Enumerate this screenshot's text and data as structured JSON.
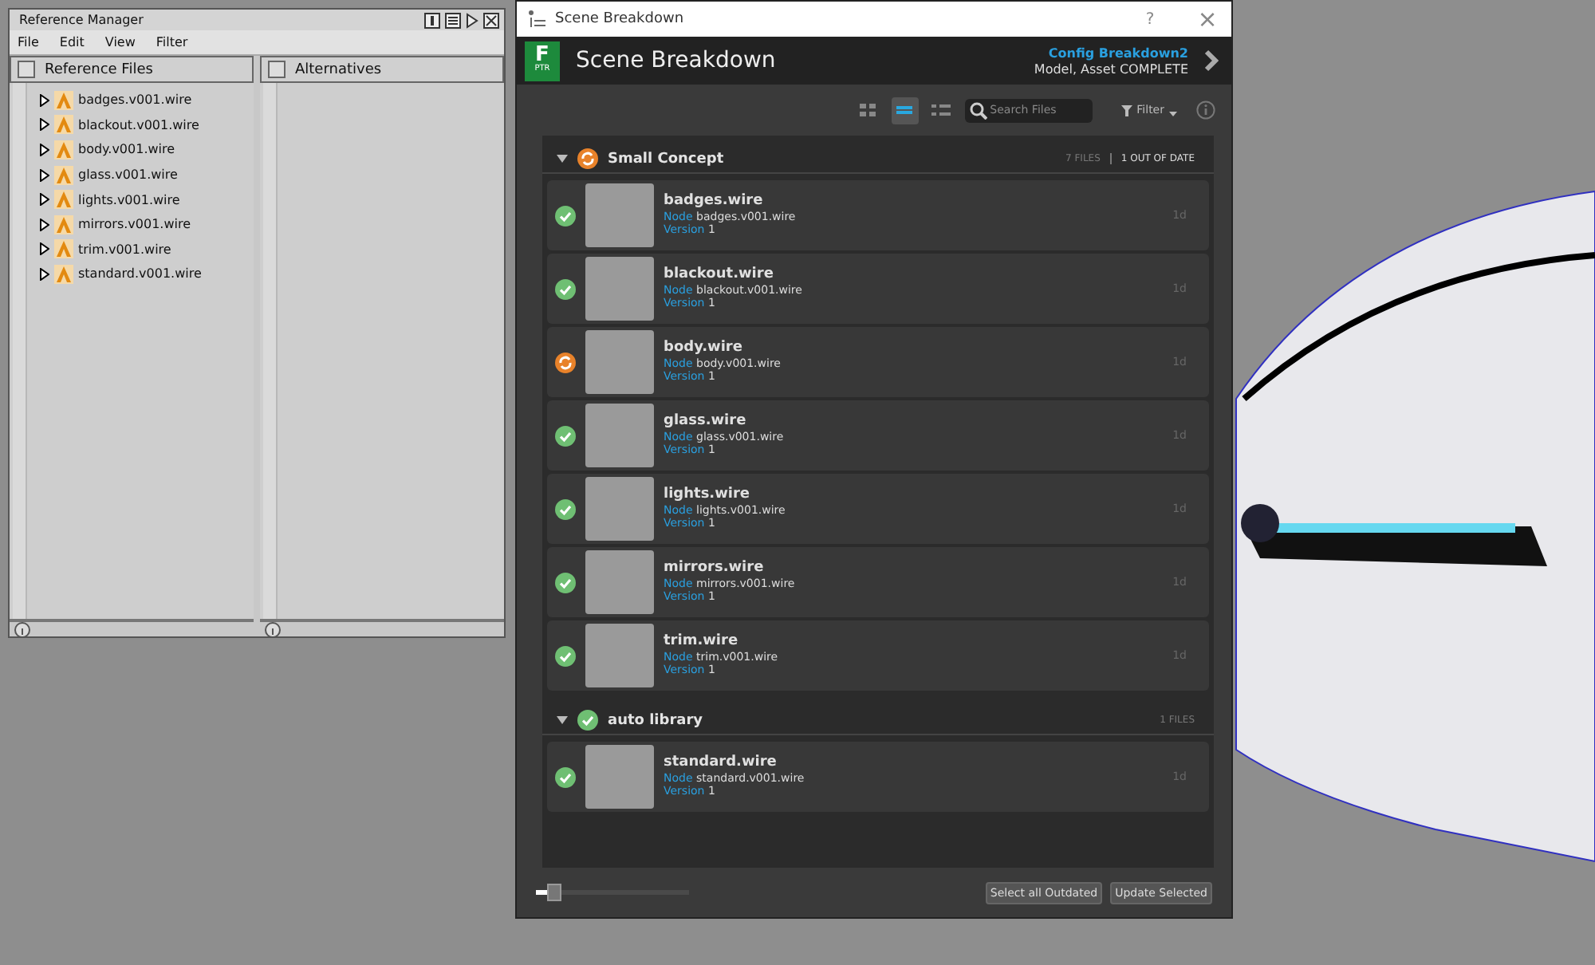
{
  "reference_manager": {
    "title": "Reference Manager",
    "menu": [
      "File",
      "Edit",
      "View",
      "Filter"
    ],
    "panes": [
      {
        "header": "Reference Files",
        "checked": false,
        "items": [
          "badges.v001.wire",
          "blackout.v001.wire",
          "body.v001.wire",
          "glass.v001.wire",
          "lights.v001.wire",
          "mirrors.v001.wire",
          "trim.v001.wire",
          "standard.v001.wire"
        ]
      },
      {
        "header": "Alternatives",
        "checked": false
      }
    ]
  },
  "scene_breakdown": {
    "window_title": "Scene Breakdown",
    "help": "?",
    "close": "×",
    "logo": {
      "letter": "F",
      "caption": "PTR"
    },
    "title": "Scene Breakdown",
    "config": "Config Breakdown2",
    "status": "Model, Asset COMPLETE",
    "view_modes": [
      {
        "kind": "grid",
        "selected": false
      },
      {
        "kind": "list",
        "selected": true
      },
      {
        "kind": "detail",
        "selected": false
      }
    ],
    "search": {
      "placeholder": "Search Files"
    },
    "filter": "Filter",
    "groups": [
      {
        "name": "Small Concept",
        "kind": "outdated",
        "expanded": true,
        "count": "7 FILES",
        "outdated": "1 OUT OF DATE",
        "items": [
          {
            "name": "badges.wire",
            "kind": "ok",
            "node_label": "Node",
            "node": "badges.v001.wire",
            "version_label": "Version",
            "version": "1",
            "age": "1d"
          },
          {
            "name": "blackout.wire",
            "kind": "ok",
            "node_label": "Node",
            "node": "blackout.v001.wire",
            "version_label": "Version",
            "version": "1",
            "age": "1d"
          },
          {
            "name": "body.wire",
            "kind": "outdated",
            "node_label": "Node",
            "node": "body.v001.wire",
            "version_label": "Version",
            "version": "1",
            "age": "1d"
          },
          {
            "name": "glass.wire",
            "kind": "ok",
            "node_label": "Node",
            "node": "glass.v001.wire",
            "version_label": "Version",
            "version": "1",
            "age": "1d"
          },
          {
            "name": "lights.wire",
            "kind": "ok",
            "node_label": "Node",
            "node": "lights.v001.wire",
            "version_label": "Version",
            "version": "1",
            "age": "1d"
          },
          {
            "name": "mirrors.wire",
            "kind": "ok",
            "node_label": "Node",
            "node": "mirrors.v001.wire",
            "version_label": "Version",
            "version": "1",
            "age": "1d"
          },
          {
            "name": "trim.wire",
            "kind": "ok",
            "node_label": "Node",
            "node": "trim.v001.wire",
            "version_label": "Version",
            "version": "1",
            "age": "1d"
          }
        ]
      },
      {
        "name": "auto library",
        "kind": "ok",
        "expanded": true,
        "count": "1 FILES",
        "items": [
          {
            "name": "standard.wire",
            "kind": "ok",
            "node_label": "Node",
            "node": "standard.v001.wire",
            "version_label": "Version",
            "version": "1",
            "age": "1d"
          }
        ]
      }
    ],
    "thumbnail_size": {
      "level": 0.1
    },
    "buttons": [
      "Select all Outdated",
      "Update Selected"
    ]
  }
}
